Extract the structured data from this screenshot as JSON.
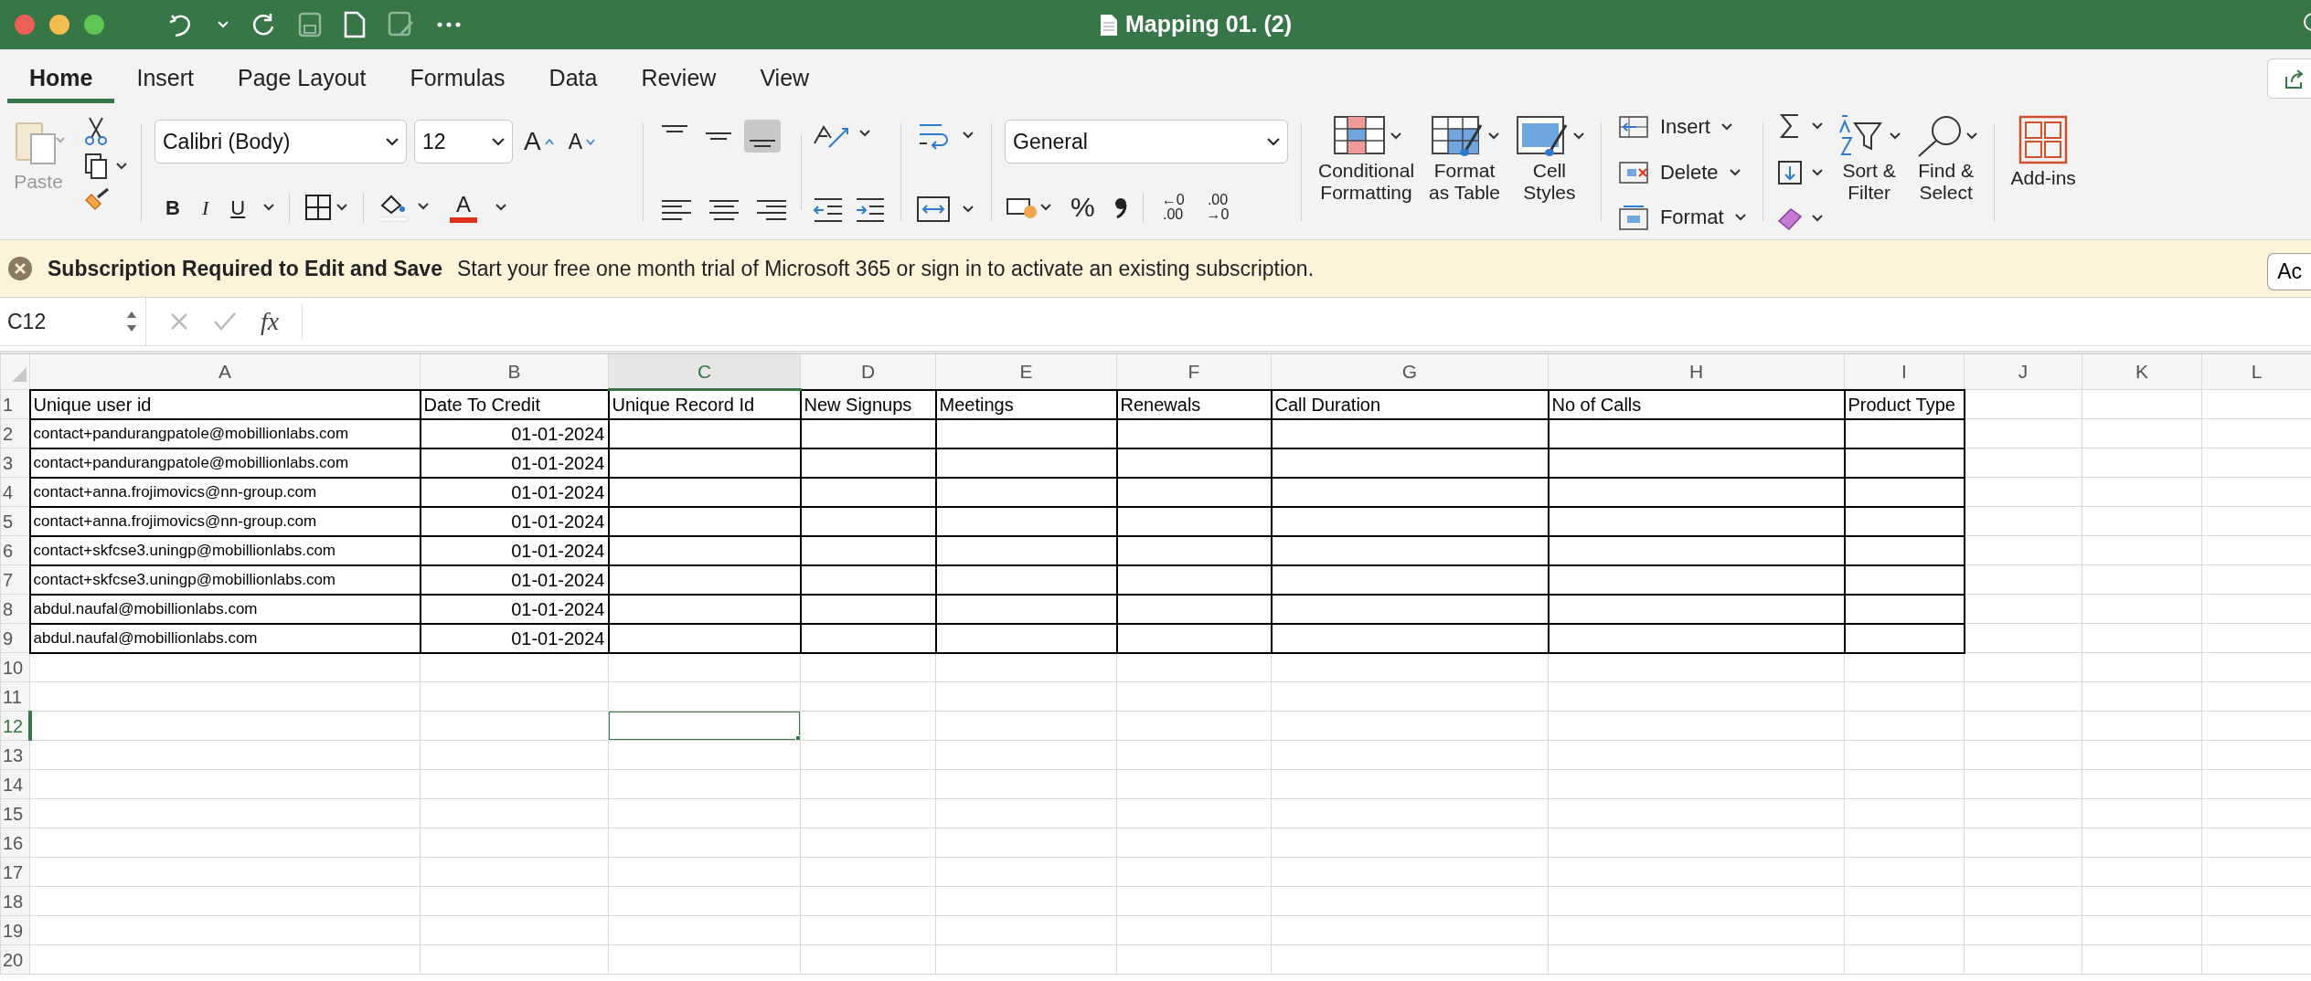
{
  "window": {
    "title": "Mapping 01. (2)"
  },
  "ribbon_tabs": [
    {
      "label": "Home",
      "selected": true
    },
    {
      "label": "Insert",
      "selected": false
    },
    {
      "label": "Page Layout",
      "selected": false
    },
    {
      "label": "Formulas",
      "selected": false
    },
    {
      "label": "Data",
      "selected": false
    },
    {
      "label": "Review",
      "selected": false
    },
    {
      "label": "View",
      "selected": false
    }
  ],
  "ribbon": {
    "paste": "Paste",
    "font_name": "Calibri (Body)",
    "font_size": "12",
    "grow_font": "A",
    "shrink_font": "A",
    "bold": "B",
    "italic": "I",
    "underline": "U",
    "font_color": "A",
    "vertical_align": [
      {
        "selected": false
      },
      {
        "selected": false
      },
      {
        "selected": true
      }
    ],
    "number_format": "General",
    "percent": "%",
    "increase_decimal": [
      "←0",
      ".00"
    ],
    "decrease_decimal": [
      ".00",
      "→0"
    ],
    "style_buttons": [
      "Conditional\nFormatting",
      "Format\nas Table",
      "Cell\nStyles"
    ],
    "cells_buttons": [
      "Insert",
      "Delete",
      "Format"
    ],
    "editing_buttons": [
      "Sort &\nFilter",
      "Find &\nSelect"
    ],
    "add_ins": "Add-ins"
  },
  "notification": {
    "title": "Subscription Required to Edit and Save",
    "message": "Start your free one month trial of Microsoft 365 or sign in to activate an existing subscription.",
    "button": "Ac"
  },
  "formula_bar": {
    "name_box": "C12",
    "function_label": "fx"
  },
  "sheet": {
    "columns": [
      {
        "label": "A",
        "selected": false
      },
      {
        "label": "B",
        "selected": false
      },
      {
        "label": "C",
        "selected": true
      },
      {
        "label": "D",
        "selected": false
      },
      {
        "label": "E",
        "selected": false
      },
      {
        "label": "F",
        "selected": false
      },
      {
        "label": "G",
        "selected": false
      },
      {
        "label": "H",
        "selected": false
      },
      {
        "label": "I",
        "selected": false
      },
      {
        "label": "J",
        "selected": false
      },
      {
        "label": "K",
        "selected": false
      },
      {
        "label": "L",
        "selected": false
      }
    ],
    "rows": [
      {
        "number": "1",
        "selected": false,
        "bordered": true,
        "cells": [
          {
            "text": "Unique user id",
            "kind": "heading"
          },
          {
            "text": "Date To Credit",
            "kind": "heading"
          },
          {
            "text": "Unique Record Id",
            "kind": "heading"
          },
          {
            "text": "New Signups",
            "kind": "heading"
          },
          {
            "text": "Meetings",
            "kind": "heading"
          },
          {
            "text": "Renewals",
            "kind": "heading"
          },
          {
            "text": "Call Duration",
            "kind": "heading"
          },
          {
            "text": "No of Calls",
            "kind": "heading"
          },
          {
            "text": "Product Type",
            "kind": "heading"
          }
        ]
      },
      {
        "number": "2",
        "selected": false,
        "bordered": true,
        "cells": [
          {
            "text": "contact+pandurangpatole@mobillionlabs.com",
            "kind": "email"
          },
          {
            "text": "01-01-2024",
            "kind": "date"
          },
          {
            "kind": "blank"
          },
          {
            "kind": "blank"
          },
          {
            "kind": "blank"
          },
          {
            "kind": "blank"
          },
          {
            "kind": "blank"
          },
          {
            "kind": "blank"
          },
          {
            "kind": "blank"
          }
        ]
      },
      {
        "number": "3",
        "selected": false,
        "bordered": true,
        "cells": [
          {
            "text": "contact+pandurangpatole@mobillionlabs.com",
            "kind": "email"
          },
          {
            "text": "01-01-2024",
            "kind": "date"
          },
          {
            "kind": "blank"
          },
          {
            "kind": "blank"
          },
          {
            "kind": "blank"
          },
          {
            "kind": "blank"
          },
          {
            "kind": "blank"
          },
          {
            "kind": "blank"
          },
          {
            "kind": "blank"
          }
        ]
      },
      {
        "number": "4",
        "selected": false,
        "bordered": true,
        "cells": [
          {
            "text": "contact+anna.frojimovics@nn-group.com",
            "kind": "email"
          },
          {
            "text": "01-01-2024",
            "kind": "date"
          },
          {
            "kind": "blank"
          },
          {
            "kind": "blank"
          },
          {
            "kind": "blank"
          },
          {
            "kind": "blank"
          },
          {
            "kind": "blank"
          },
          {
            "kind": "blank"
          },
          {
            "kind": "blank"
          }
        ]
      },
      {
        "number": "5",
        "selected": false,
        "bordered": true,
        "cells": [
          {
            "text": "contact+anna.frojimovics@nn-group.com",
            "kind": "email"
          },
          {
            "text": "01-01-2024",
            "kind": "date"
          },
          {
            "kind": "blank"
          },
          {
            "kind": "blank"
          },
          {
            "kind": "blank"
          },
          {
            "kind": "blank"
          },
          {
            "kind": "blank"
          },
          {
            "kind": "blank"
          },
          {
            "kind": "blank"
          }
        ]
      },
      {
        "number": "6",
        "selected": false,
        "bordered": true,
        "cells": [
          {
            "text": "contact+skfcse3.uningp@mobillionlabs.com",
            "kind": "email"
          },
          {
            "text": "01-01-2024",
            "kind": "date"
          },
          {
            "kind": "blank"
          },
          {
            "kind": "blank"
          },
          {
            "kind": "blank"
          },
          {
            "kind": "blank"
          },
          {
            "kind": "blank"
          },
          {
            "kind": "blank"
          },
          {
            "kind": "blank"
          }
        ]
      },
      {
        "number": "7",
        "selected": false,
        "bordered": true,
        "cells": [
          {
            "text": "contact+skfcse3.uningp@mobillionlabs.com",
            "kind": "email"
          },
          {
            "text": "01-01-2024",
            "kind": "date"
          },
          {
            "kind": "blank"
          },
          {
            "kind": "blank"
          },
          {
            "kind": "blank"
          },
          {
            "kind": "blank"
          },
          {
            "kind": "blank"
          },
          {
            "kind": "blank"
          },
          {
            "kind": "blank"
          }
        ]
      },
      {
        "number": "8",
        "selected": false,
        "bordered": true,
        "cells": [
          {
            "text": "abdul.naufal@mobillionlabs.com",
            "kind": "email"
          },
          {
            "text": "01-01-2024",
            "kind": "date"
          },
          {
            "kind": "blank"
          },
          {
            "kind": "blank"
          },
          {
            "kind": "blank"
          },
          {
            "kind": "blank"
          },
          {
            "kind": "blank"
          },
          {
            "kind": "blank"
          },
          {
            "kind": "blank"
          }
        ]
      },
      {
        "number": "9",
        "selected": false,
        "bordered": true,
        "cells": [
          {
            "text": "abdul.naufal@mobillionlabs.com",
            "kind": "email"
          },
          {
            "text": "01-01-2024",
            "kind": "date"
          },
          {
            "kind": "blank"
          },
          {
            "kind": "blank"
          },
          {
            "kind": "blank"
          },
          {
            "kind": "blank"
          },
          {
            "kind": "blank"
          },
          {
            "kind": "blank"
          },
          {
            "kind": "blank"
          }
        ]
      },
      {
        "number": "10",
        "selected": false
      },
      {
        "number": "11",
        "selected": false
      },
      {
        "number": "12",
        "selected": true
      },
      {
        "number": "13",
        "selected": false
      },
      {
        "number": "14",
        "selected": false
      },
      {
        "number": "15",
        "selected": false
      },
      {
        "number": "16",
        "selected": false
      },
      {
        "number": "17",
        "selected": false
      },
      {
        "number": "18",
        "selected": false
      },
      {
        "number": "19",
        "selected": false
      },
      {
        "number": "20",
        "selected": false
      }
    ]
  }
}
